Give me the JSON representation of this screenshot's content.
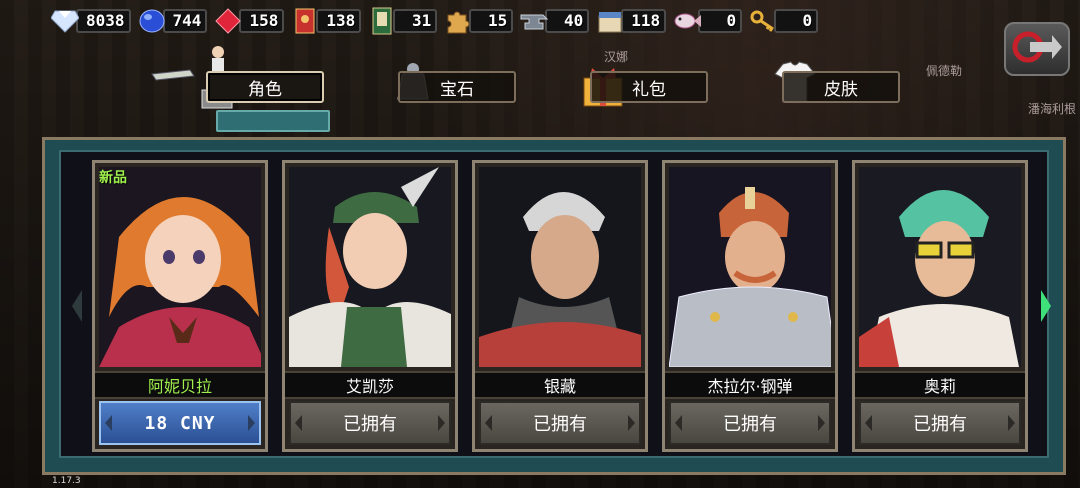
{
  "resources": [
    {
      "icon": "diamond-icon",
      "value": "8038"
    },
    {
      "icon": "blue-gem-icon",
      "value": "744"
    },
    {
      "icon": "red-gem-icon",
      "value": "158"
    },
    {
      "icon": "red-ticket-icon",
      "value": "138"
    },
    {
      "icon": "card-icon",
      "value": "31"
    },
    {
      "icon": "puzzle-icon",
      "value": "15"
    },
    {
      "icon": "anvil-icon",
      "value": "40"
    },
    {
      "icon": "supply-box-icon",
      "value": "118"
    },
    {
      "icon": "fish-icon",
      "value": "0"
    },
    {
      "icon": "key-icon",
      "value": "0"
    }
  ],
  "side_names": {
    "top": "汉娜",
    "right1": "佩德勒",
    "right2": "潘海利根"
  },
  "tabs": [
    {
      "label": "角色",
      "icon": "character-icon",
      "active": true
    },
    {
      "label": "宝石",
      "icon": "gem-sack-icon",
      "active": false
    },
    {
      "label": "礼包",
      "icon": "gift-box-icon",
      "active": false
    },
    {
      "label": "皮肤",
      "icon": "shirt-icon",
      "active": false
    }
  ],
  "cards": [
    {
      "name": "阿妮贝拉",
      "new": true,
      "new_label": "新品",
      "button": "18 CNY",
      "buy": true
    },
    {
      "name": "艾凯莎",
      "new": false,
      "button": "已拥有",
      "buy": false
    },
    {
      "name": "银藏",
      "new": false,
      "button": "已拥有",
      "buy": false
    },
    {
      "name": "杰拉尔·钢弹",
      "new": false,
      "button": "已拥有",
      "buy": false
    },
    {
      "name": "奥莉",
      "new": false,
      "button": "已拥有",
      "buy": false
    }
  ],
  "version": "1.17.3",
  "colors": {
    "panel": "#1f4c52",
    "accent_new": "#9ff04e",
    "buy_button": "#3a66b0"
  }
}
